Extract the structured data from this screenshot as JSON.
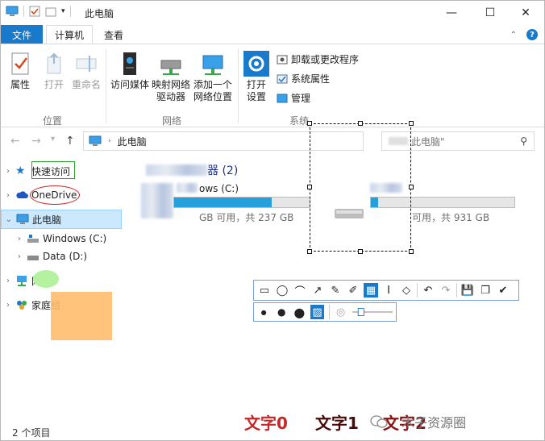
{
  "window": {
    "title": "此电脑",
    "minimize": "—",
    "maximize": "☐",
    "close": "✕"
  },
  "tabs": {
    "file": "文件",
    "computer": "计算机",
    "view": "查看"
  },
  "ribbon": {
    "location": {
      "label": "位置",
      "properties": "属性",
      "open": "打开",
      "rename": "重命名"
    },
    "network": {
      "label": "网络",
      "access_media": "访问媒体",
      "map_drive_line1": "映射网络",
      "map_drive_line2": "驱动器",
      "add_location_line1": "添加一个",
      "add_location_line2": "网络位置"
    },
    "system": {
      "label": "系统",
      "open_settings_line1": "打开",
      "open_settings_line2": "设置",
      "uninstall": "卸载或更改程序",
      "system_properties": "系统属性",
      "manage": "管理"
    }
  },
  "address": {
    "path": "此电脑",
    "search_placeholder": "此电脑\""
  },
  "sidebar": {
    "quick_access": "快速访问",
    "onedrive": "OneDrive",
    "this_pc": "此电脑",
    "windows_c": "Windows (C:)",
    "data_d": "Data (D:)",
    "network": "网络",
    "homegroup": "家庭组"
  },
  "content": {
    "group_suffix": "器 (2)",
    "drive1_name": "ows (C:)",
    "drive1_info": "GB 可用，共 237 GB",
    "drive1_usage": 0.72,
    "drive2_info": "可用，共 931 GB",
    "drive2_usage": 0.05
  },
  "annotations": {
    "text0": "文字0",
    "text1": "文字1",
    "text2": "文字2",
    "text0_color": "#c62828",
    "text1_color": "#4a0a0a",
    "text2_color": "#8b1010"
  },
  "watermark": "木子资源圈",
  "watermark_dot": "·",
  "status": "2 个项目",
  "colors": {
    "accent": "#1979ca",
    "selection": "#cce8ff",
    "progress": "#26a0da"
  }
}
